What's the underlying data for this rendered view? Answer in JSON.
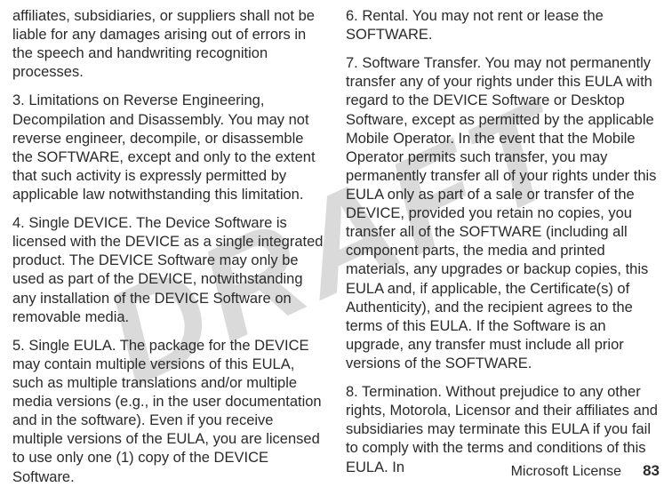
{
  "watermark": "DRAFT",
  "left_column": {
    "p1": "affiliates, subsidiaries, or suppliers shall not be liable for any damages arising out of errors in the speech and handwriting recognition processes.",
    "p2": "3. Limitations on Reverse Engineering, Decompilation and Disassembly. You may not reverse engineer, decompile, or disassemble the SOFTWARE, except and only to the extent that such activity is expressly permitted by applicable law notwithstanding this limitation.",
    "p3": "4. Single DEVICE. The Device Software is licensed with the DEVICE as a single integrated product. The DEVICE Software may only be used as part of the DEVICE, notwithstanding any installation of the DEVICE Software on removable media.",
    "p4": "5. Single EULA. The package for the DEVICE may contain multiple versions of this EULA, such as multiple translations and/or multiple media versions (e.g., in the user documentation and in the software). Even if you receive multiple versions of the EULA, you are licensed to use only one (1) copy of the DEVICE Software."
  },
  "right_column": {
    "p1": "6. Rental. You may not rent or lease the SOFTWARE.",
    "p2": "7. Software Transfer. You may not permanently transfer any of your rights under this EULA with regard to the DEVICE Software or Desktop Software, except as permitted by the applicable Mobile Operator. In the event that the Mobile Operator permits such transfer, you may permanently transfer all of your rights under this EULA only as part of a sale or transfer of the DEVICE, provided you retain no copies, you transfer all of the SOFTWARE (including all component parts, the media and printed materials, any upgrades or backup copies, this EULA and, if applicable, the Certificate(s) of Authenticity), and the recipient agrees to the terms of this EULA. If the Software is an upgrade, any transfer must include all prior versions of the SOFTWARE.",
    "p3": "8. Termination. Without prejudice to any other rights, Motorola, Licensor and their affiliates and subsidiaries may terminate this EULA if you fail to comply with the terms and conditions of this EULA. In"
  },
  "footer": {
    "title": "Microsoft License",
    "page": "83"
  }
}
